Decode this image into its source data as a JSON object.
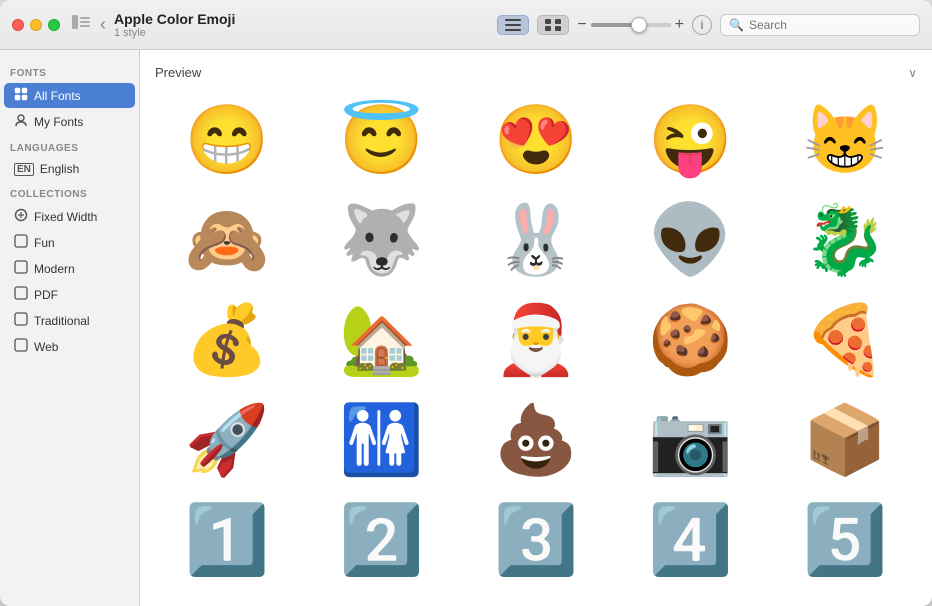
{
  "window": {
    "title": "Apple Color Emoji",
    "subtitle": "1 style"
  },
  "titlebar": {
    "back_icon": "‹",
    "sidebar_icon": "⊟",
    "list_view_icon": "≡",
    "grid_view_icon": "⊟",
    "info_icon": "i",
    "search_placeholder": "Search"
  },
  "sidebar": {
    "fonts_label": "Fonts",
    "all_fonts_label": "All Fonts",
    "my_fonts_label": "My Fonts",
    "languages_label": "Languages",
    "english_label": "English",
    "collections_label": "Collections",
    "fixed_width_label": "Fixed Width",
    "fun_label": "Fun",
    "modern_label": "Modern",
    "pdf_label": "PDF",
    "traditional_label": "Traditional",
    "web_label": "Web"
  },
  "preview": {
    "label": "Preview",
    "emojis": [
      "😁",
      "😇",
      "😍",
      "😜",
      "😸",
      "🙈",
      "🐺",
      "🐰",
      "👽",
      "🐉",
      "💰",
      "🏡",
      "🎅",
      "🍪",
      "🍕",
      "🚀",
      "🚻",
      "💩",
      "📷",
      "📦",
      "1️⃣",
      "2️⃣",
      "3️⃣",
      "4️⃣",
      "5️⃣"
    ]
  }
}
